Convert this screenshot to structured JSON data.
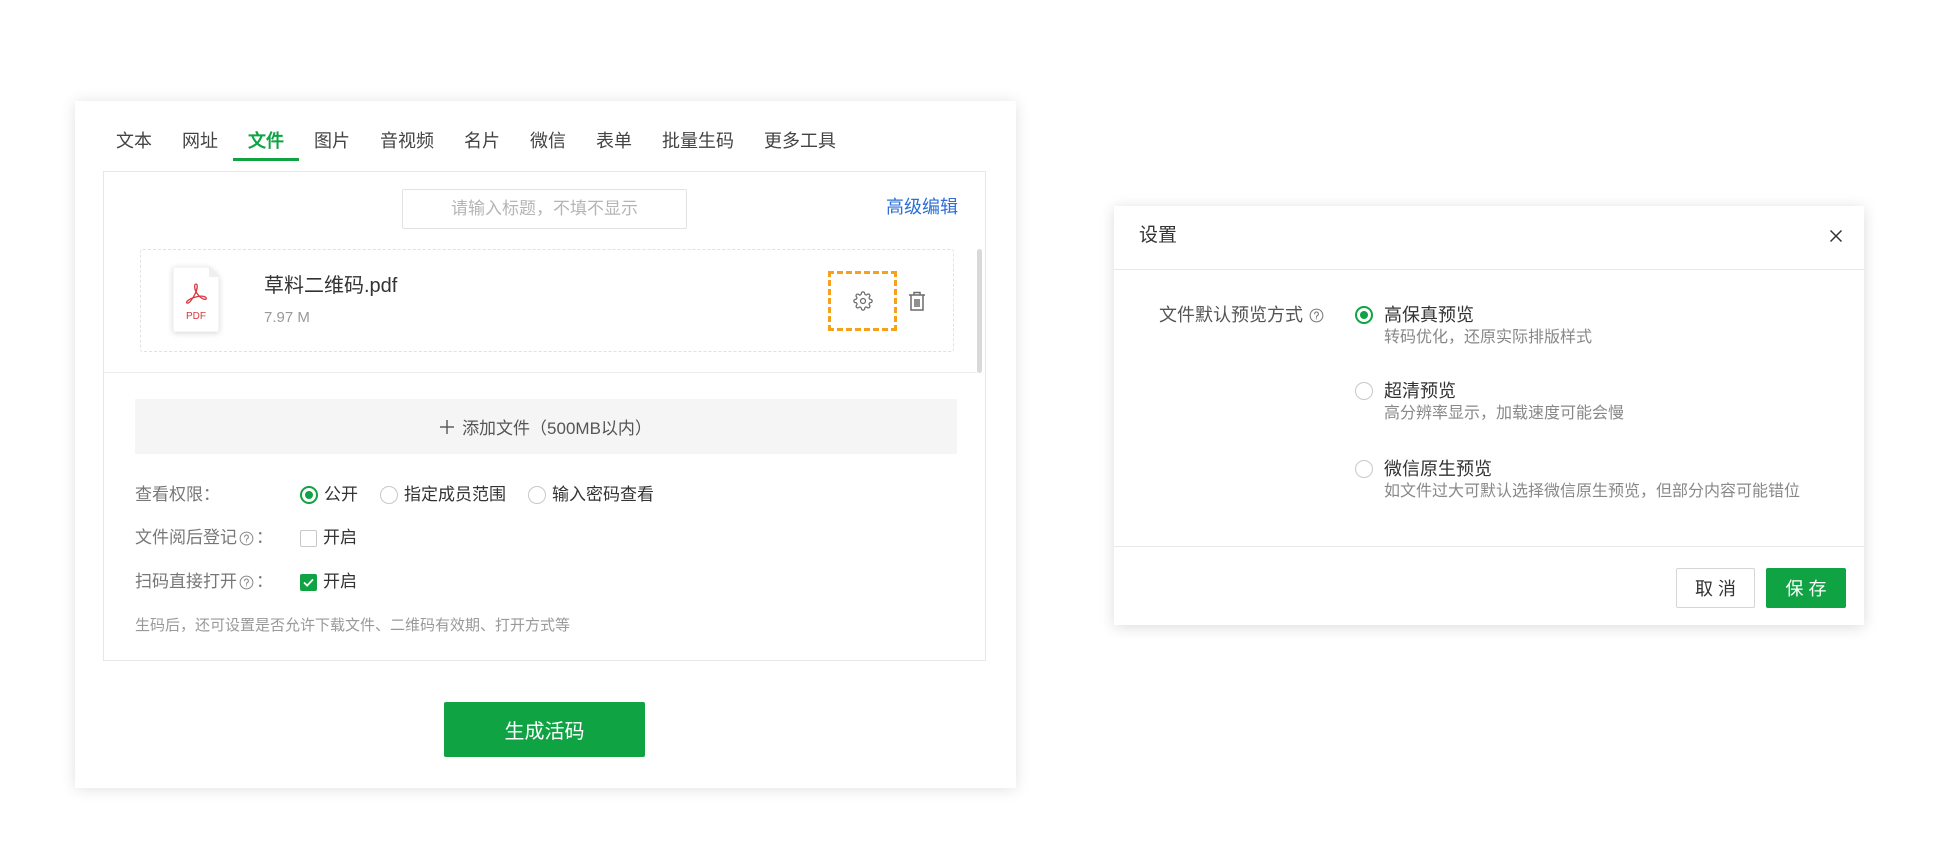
{
  "colors": {
    "brand_green": "#0fa344",
    "link_blue": "#2d6fd6",
    "highlight_orange": "#f5a11c"
  },
  "tabs": {
    "items": [
      {
        "label": "文本",
        "active": false
      },
      {
        "label": "网址",
        "active": false
      },
      {
        "label": "文件",
        "active": true
      },
      {
        "label": "图片",
        "active": false
      },
      {
        "label": "音视频",
        "active": false
      },
      {
        "label": "名片",
        "active": false
      },
      {
        "label": "微信",
        "active": false
      },
      {
        "label": "表单",
        "active": false
      },
      {
        "label": "批量生码",
        "active": false
      },
      {
        "label": "更多工具",
        "active": false
      }
    ]
  },
  "editor": {
    "title_input": {
      "value": "",
      "placeholder": "请输入标题，不填不显示"
    },
    "advanced_edit_label": "高级编辑",
    "file": {
      "type_icon": "pdf-file-icon",
      "type_label": "PDF",
      "name": "草料二维码.pdf",
      "size": "7.97 M",
      "settings_icon": "gear-icon",
      "delete_icon": "trash-icon"
    },
    "add_file": {
      "icon": "plus-icon",
      "label": "添加文件（500MB以内）"
    }
  },
  "settings": {
    "view_permission": {
      "label": "查看权限：",
      "choices": [
        {
          "label": "公开",
          "selected": true
        },
        {
          "label": "指定成员范围",
          "selected": false
        },
        {
          "label": "输入密码查看",
          "selected": false
        }
      ]
    },
    "read_register": {
      "label": "文件阅后登记",
      "help_icon": "question-circle-icon",
      "colon": "：",
      "option_label": "开启",
      "checked": false
    },
    "direct_open": {
      "label": "扫码直接打开",
      "help_icon": "question-circle-icon",
      "colon": "：",
      "option_label": "开启",
      "checked": true
    },
    "hint": "生码后，还可设置是否允许下载文件、二维码有效期、打开方式等"
  },
  "generate_button_label": "生成活码",
  "dialog": {
    "title": "设置",
    "close_icon": "close-icon",
    "field_label": "文件默认预览方式",
    "field_help_icon": "question-circle-icon",
    "preview_options": [
      {
        "label": "高保真预览",
        "desc": "转码优化，还原实际排版样式",
        "selected": true
      },
      {
        "label": "超清预览",
        "desc": "高分辨率显示，加载速度可能会慢",
        "selected": false
      },
      {
        "label": "微信原生预览",
        "desc": "如文件过大可默认选择微信原生预览，但部分内容可能错位",
        "selected": false
      }
    ],
    "cancel_label": "取 消",
    "save_label": "保 存"
  }
}
